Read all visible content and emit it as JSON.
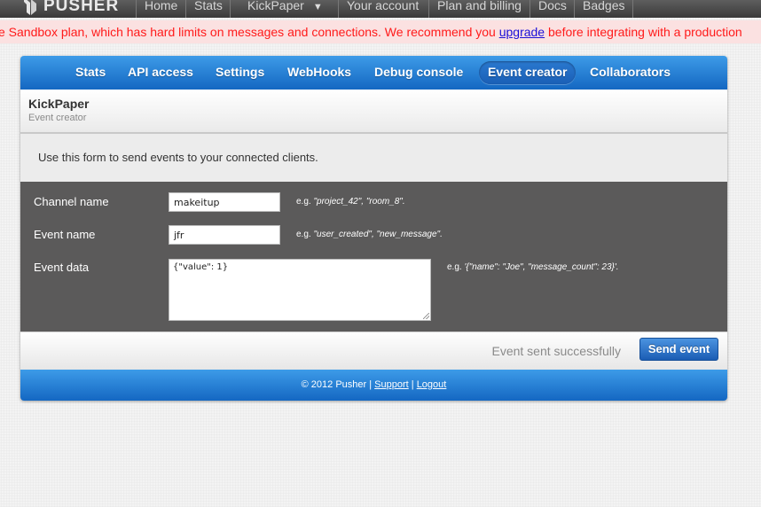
{
  "topnav": {
    "brand": "PUSHER",
    "items": [
      "Home",
      "Stats",
      "KickPaper",
      "Your account",
      "Plan and billing",
      "Docs",
      "Badges"
    ]
  },
  "banner": {
    "text_before": "e Sandbox plan, which has hard limits on messages and connections. We recommend you ",
    "link": "upgrade",
    "text_after": " before integrating with a production"
  },
  "tabs": [
    "Stats",
    "API access",
    "Settings",
    "WebHooks",
    "Debug console",
    "Event creator",
    "Collaborators"
  ],
  "active_tab": "Event creator",
  "app": {
    "name": "KickPaper",
    "subtitle": "Event creator"
  },
  "intro": "Use this form to send events to your connected clients.",
  "form": {
    "channel": {
      "label": "Channel name",
      "value": "makeitup",
      "hint_prefix": "e.g. ",
      "hint_example": "\"project_42\", \"room_8\"."
    },
    "event": {
      "label": "Event name",
      "value": "jfr",
      "hint_prefix": "e.g. ",
      "hint_example": "\"user_created\", \"new_message\"."
    },
    "data": {
      "label": "Event data",
      "value": "{\"value\": 1}",
      "hint_prefix": "e.g. ",
      "hint_example": "'{\"name\": \"Joe\", \"message_count\": 23}'."
    }
  },
  "status": "Event sent successfully",
  "send_button": "Send event",
  "footer": {
    "copyright": "© 2012 Pusher |",
    "support": "Support",
    "separator": "|",
    "logout": "Logout"
  },
  "colors": {
    "nav_bg": "#4a4a4a",
    "banner_bg": "#fbe1e1",
    "banner_text": "#ff1a1a",
    "accent_blue": "#1f72cc",
    "form_bg": "#5b5a5a"
  }
}
